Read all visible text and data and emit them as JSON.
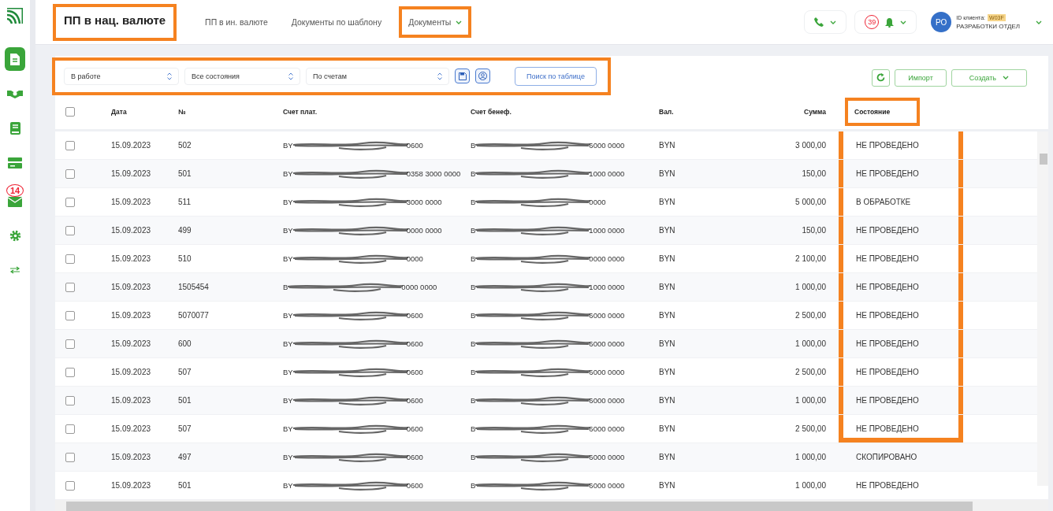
{
  "sidebar": {
    "items": [
      {
        "kind": "document",
        "selected": true
      },
      {
        "kind": "exchange",
        "selected": false
      },
      {
        "kind": "book",
        "selected": false
      },
      {
        "kind": "card",
        "selected": false
      },
      {
        "kind": "mail",
        "selected": false,
        "badge": "14"
      },
      {
        "kind": "settings",
        "selected": false
      },
      {
        "kind": "transfer",
        "selected": false
      }
    ]
  },
  "header": {
    "title": "ПП в нац. валюте",
    "title_highlighted": true,
    "tabs": [
      {
        "label": "ПП в ин. валюте",
        "dropdown": false,
        "highlighted": false
      },
      {
        "label": "Документы по шаблону",
        "dropdown": false,
        "highlighted": false
      },
      {
        "label": "Документы",
        "dropdown": true,
        "highlighted": true
      }
    ],
    "notifications_count": "39",
    "avatar_initials": "РО",
    "client_id_label": "ID клиента:",
    "client_id": "W03F",
    "organization": "РАЗРАБОТКИ ОТДЕЛ"
  },
  "toolbar": {
    "highlighted": true,
    "selects": [
      "В работе",
      "Все состояния",
      "По счетам"
    ],
    "search_button": "Поиск по таблице",
    "import_button": "Импорт",
    "create_button": "Создать"
  },
  "table": {
    "status_header_highlighted": true,
    "columns": [
      {
        "kind": "checkbox",
        "checked": false
      },
      {
        "kind": "text",
        "label": "Дата"
      },
      {
        "kind": "text",
        "label": "№"
      },
      {
        "kind": "text",
        "label": "Счет плат."
      },
      {
        "kind": "text",
        "label": "Счет бенеф."
      },
      {
        "kind": "text",
        "label": "Вал."
      },
      {
        "kind": "number",
        "label": "Сумма"
      },
      {
        "kind": "status",
        "label": "Состояние"
      }
    ],
    "rows": [
      {
        "checked": false,
        "date": "15.09.2023",
        "number": "502",
        "payer": {
          "start": "BY",
          "end": "0600"
        },
        "beneficiary": {
          "start": "B",
          "end": "6000 0000"
        },
        "currency": "BYN",
        "amount": "3 000,00",
        "status": "НЕ ПРОВЕДЕНО",
        "highlighted": true
      },
      {
        "checked": false,
        "date": "15.09.2023",
        "number": "501",
        "payer": {
          "start": "BY",
          "end": "0358 3000 0000"
        },
        "beneficiary": {
          "start": "B",
          "end": "1000 0000"
        },
        "currency": "BYN",
        "amount": "150,00",
        "status": "НЕ ПРОВЕДЕНО",
        "highlighted": true
      },
      {
        "checked": false,
        "date": "15.09.2023",
        "number": "511",
        "payer": {
          "start": "BY",
          "end": "3000 0000"
        },
        "beneficiary": {
          "start": "B",
          "end": "0000"
        },
        "currency": "BYN",
        "amount": "5 000,00",
        "status": "В ОБРАБОТКЕ",
        "highlighted": true
      },
      {
        "checked": false,
        "date": "15.09.2023",
        "number": "499",
        "payer": {
          "start": "BY",
          "end": "0000 0000"
        },
        "beneficiary": {
          "start": "B",
          "end": "1000 0000"
        },
        "currency": "BYN",
        "amount": "150,00",
        "status": "НЕ ПРОВЕДЕНО",
        "highlighted": true
      },
      {
        "checked": false,
        "date": "15.09.2023",
        "number": "510",
        "payer": {
          "start": "BY",
          "end": "0000"
        },
        "beneficiary": {
          "start": "B",
          "end": "0000 0000"
        },
        "currency": "BYN",
        "amount": "2 100,00",
        "status": "НЕ ПРОВЕДЕНО",
        "highlighted": true
      },
      {
        "checked": false,
        "date": "15.09.2023",
        "number": "1505454",
        "payer": {
          "start": "B",
          "end": "0000 0000"
        },
        "beneficiary": {
          "start": "B",
          "end": "1000 0000"
        },
        "currency": "BYN",
        "amount": "1 000,00",
        "status": "НЕ ПРОВЕДЕНО",
        "highlighted": true
      },
      {
        "checked": false,
        "date": "15.09.2023",
        "number": "5070077",
        "payer": {
          "start": "BY",
          "end": "0600"
        },
        "beneficiary": {
          "start": "B",
          "end": "6000 0000"
        },
        "currency": "BYN",
        "amount": "2 500,00",
        "status": "НЕ ПРОВЕДЕНО",
        "highlighted": true
      },
      {
        "checked": false,
        "date": "15.09.2023",
        "number": "600",
        "payer": {
          "start": "BY",
          "end": "0600"
        },
        "beneficiary": {
          "start": "B",
          "end": "6000 0000"
        },
        "currency": "BYN",
        "amount": "1 000,00",
        "status": "НЕ ПРОВЕДЕНО",
        "highlighted": true
      },
      {
        "checked": false,
        "date": "15.09.2023",
        "number": "507",
        "payer": {
          "start": "BY",
          "end": "0600"
        },
        "beneficiary": {
          "start": "B",
          "end": "6000 0000"
        },
        "currency": "BYN",
        "amount": "2 500,00",
        "status": "НЕ ПРОВЕДЕНО",
        "highlighted": true
      },
      {
        "checked": false,
        "date": "15.09.2023",
        "number": "501",
        "payer": {
          "start": "BY",
          "end": "0600"
        },
        "beneficiary": {
          "start": "B",
          "end": "6000 0000"
        },
        "currency": "BYN",
        "amount": "1 000,00",
        "status": "НЕ ПРОВЕДЕНО",
        "highlighted": true
      },
      {
        "checked": false,
        "date": "15.09.2023",
        "number": "507",
        "payer": {
          "start": "BY",
          "end": "0600"
        },
        "beneficiary": {
          "start": "B",
          "end": "6000 0000"
        },
        "currency": "BYN",
        "amount": "2 500,00",
        "status": "НЕ ПРОВЕДЕНО",
        "highlighted": true
      },
      {
        "checked": false,
        "date": "15.09.2023",
        "number": "497",
        "payer": {
          "start": "BY",
          "end": "0600"
        },
        "beneficiary": {
          "start": "B",
          "end": "6000 0000"
        },
        "currency": "BYN",
        "amount": "1 000,00",
        "status": "СКОПИРОВАНО",
        "highlighted": false
      },
      {
        "checked": false,
        "date": "15.09.2023",
        "number": "501",
        "payer": {
          "start": "BY",
          "end": "0600"
        },
        "beneficiary": {
          "start": "B",
          "end": "6000 0000"
        },
        "currency": "BYN",
        "amount": "1 000,00",
        "status": "НЕ ПРОВЕДЕНО",
        "highlighted": false
      }
    ]
  }
}
